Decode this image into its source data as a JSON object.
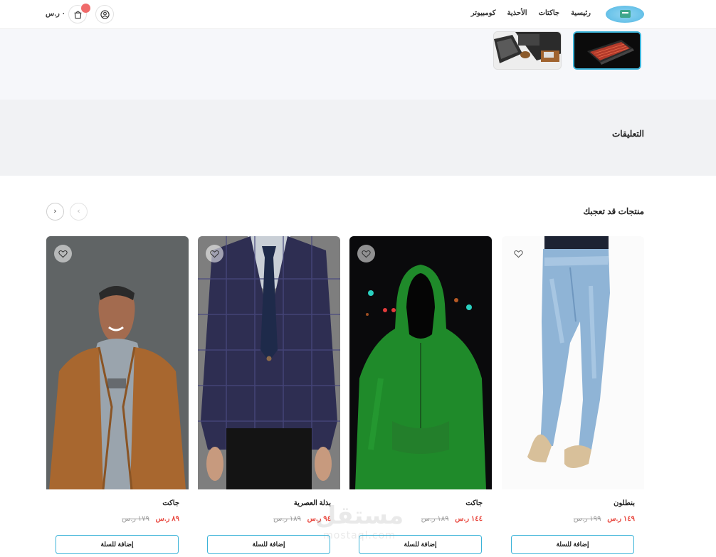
{
  "header": {
    "nav": [
      "رئيسية",
      "جاكتات",
      "الأحذية",
      "كومبيوتر"
    ],
    "cart_total": "٠ ر.س",
    "icons": {
      "logo": "store-logo",
      "cart": "shopping-bag-icon",
      "user": "user-icon"
    }
  },
  "gallery": {
    "thumbnails": [
      "laptop-keyboard",
      "desk-workspace"
    ]
  },
  "comments": {
    "title": "التعليقات"
  },
  "recommended": {
    "title": "منتجات قد تعجبك",
    "products": [
      {
        "name": "بنطلون",
        "price": "١٤٩ ر.س",
        "old_price": "١٩٩ ر.س",
        "button": "إضافة للسلة"
      },
      {
        "name": "جاكت",
        "price": "١٤٤ ر.س",
        "old_price": "١٨٩ ر.س",
        "button": "إضافة للسلة"
      },
      {
        "name": "بذلة العصرية",
        "price": "٩٤ ر.س",
        "old_price": "١٨٩ ر.س",
        "button": "إضافة للسلة"
      },
      {
        "name": "جاكت",
        "price": "٨٩ ر.س",
        "old_price": "١٧٩ ر.س",
        "button": "إضافة للسلة"
      }
    ]
  },
  "watermark": {
    "top": "مستقل",
    "bottom": "mostaql.com"
  },
  "colors": {
    "accent": "#3bb3d8",
    "sale": "#e8453c",
    "badge": "#f06b6b"
  }
}
